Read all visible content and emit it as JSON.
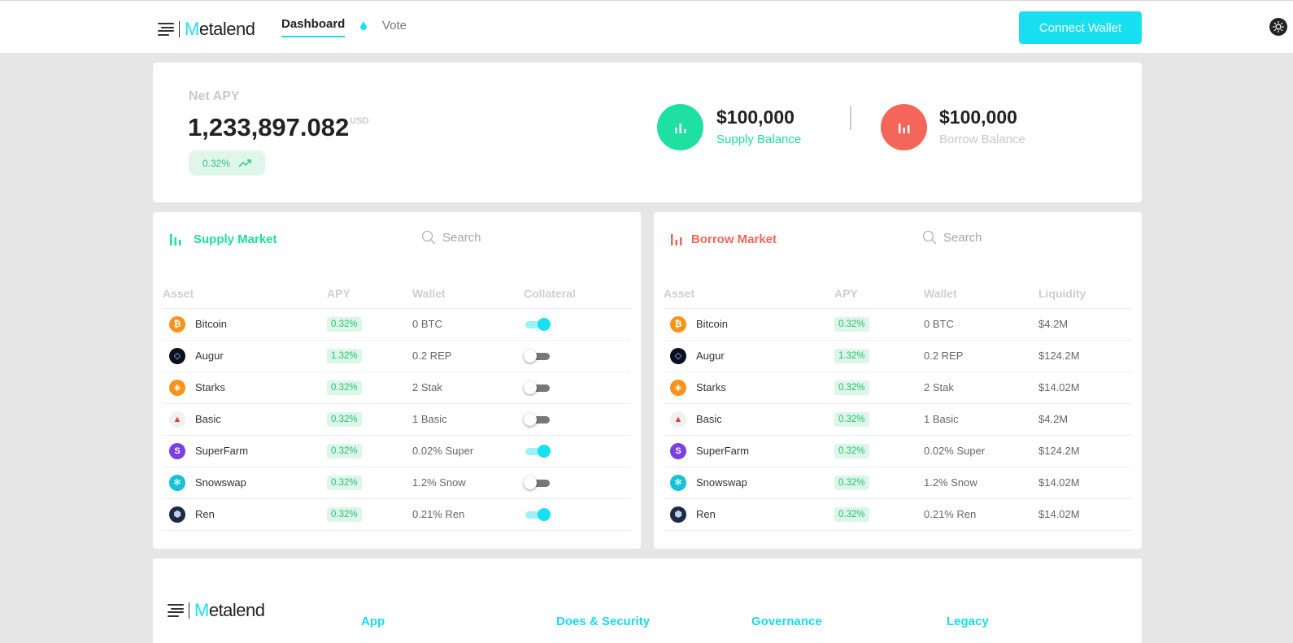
{
  "header": {
    "logo_prefix": "M",
    "logo_rest": "etalend",
    "nav": {
      "dashboard": "Dashboard",
      "vote": "Vote"
    },
    "connect_wallet": "Connect Wallet",
    "theme_icon": "sun-icon"
  },
  "summary": {
    "net_apy_label": "Net APY",
    "net_apy_value": "1,233,897.082",
    "net_apy_unit": "USD",
    "net_apy_change": "0.32%",
    "supply_amount": "$100,000",
    "supply_label": "Supply Balance",
    "borrow_amount": "$100,000",
    "borrow_label": "Borrow Balance"
  },
  "supply_market": {
    "title": "Supply Market",
    "search_placeholder": "Search",
    "columns": [
      "Asset",
      "APY",
      "Wallet",
      "Collateral"
    ],
    "rows": [
      {
        "asset": "Bitcoin",
        "apy": "0.32%",
        "wallet": "0 BTC",
        "collateral": true
      },
      {
        "asset": "Augur",
        "apy": "1.32%",
        "wallet": "0.2 REP",
        "collateral": false
      },
      {
        "asset": "Starks",
        "apy": "0.32%",
        "wallet": "2 Stak",
        "collateral": false
      },
      {
        "asset": "Basic",
        "apy": "0.32%",
        "wallet": "1 Basic",
        "collateral": false
      },
      {
        "asset": "SuperFarm",
        "apy": "0.32%",
        "wallet": "0.02% Super",
        "collateral": true
      },
      {
        "asset": "Snowswap",
        "apy": "0.32%",
        "wallet": "1.2% Snow",
        "collateral": false
      },
      {
        "asset": "Ren",
        "apy": "0.32%",
        "wallet": "0.21% Ren",
        "collateral": true
      }
    ]
  },
  "borrow_market": {
    "title": "Borrow Market",
    "search_placeholder": "Search",
    "columns": [
      "Asset",
      "APY",
      "Wallet",
      "Liquidity"
    ],
    "rows": [
      {
        "asset": "Bitcoin",
        "apy": "0.32%",
        "wallet": "0 BTC",
        "liquidity": "$4.2M"
      },
      {
        "asset": "Augur",
        "apy": "1.32%",
        "wallet": "0.2 REP",
        "liquidity": "$124.2M"
      },
      {
        "asset": "Starks",
        "apy": "0.32%",
        "wallet": "2 Stak",
        "liquidity": "$14.02M"
      },
      {
        "asset": "Basic",
        "apy": "0.32%",
        "wallet": "1 Basic",
        "liquidity": "$4.2M"
      },
      {
        "asset": "SuperFarm",
        "apy": "0.32%",
        "wallet": "0.02% Super",
        "liquidity": "$124.2M"
      },
      {
        "asset": "Snowswap",
        "apy": "0.32%",
        "wallet": "1.2% Snow",
        "liquidity": "$14.02M"
      },
      {
        "asset": "Ren",
        "apy": "0.32%",
        "wallet": "0.21% Ren",
        "liquidity": "$14.02M"
      }
    ]
  },
  "footer": {
    "links": [
      "App",
      "Does & Security",
      "Governance",
      "Legacy"
    ]
  },
  "colors": {
    "accent": "#18e0f0",
    "supply": "#1ee0a0",
    "borrow": "#f5665a",
    "apy_pill_bg": "#dcf6e8",
    "apy_pill_text": "#2bbf72"
  },
  "coin_icons": {
    "Bitcoin": "bitcoin-icon",
    "Augur": "augur-icon",
    "Starks": "starks-icon",
    "Basic": "basic-attention-icon",
    "SuperFarm": "superfarm-icon",
    "Snowswap": "snowswap-icon",
    "Ren": "ren-icon"
  }
}
